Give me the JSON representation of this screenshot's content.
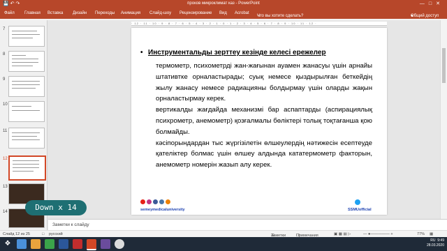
{
  "window": {
    "title": "проков микроклимат каз - PowerPoint"
  },
  "ribbon": {
    "tabs": [
      "Файл",
      "Главная",
      "Вставка",
      "Дизайн",
      "Переходы",
      "Анимация",
      "Слайд-шоу",
      "Рецензирование",
      "Вид",
      "Acrobat"
    ],
    "tell_me": "Что вы хотите сделать?",
    "share": "Общий доступ"
  },
  "thumbnails": [
    {
      "num": "7"
    },
    {
      "num": "8"
    },
    {
      "num": "9"
    },
    {
      "num": "10"
    },
    {
      "num": "11"
    },
    {
      "num": "12"
    },
    {
      "num": "13"
    },
    {
      "num": "14"
    }
  ],
  "slide": {
    "bullet": "Инструментальды  зерттеу кезінде келесі ережелер",
    "paragraphs": [
      "термометр, психометрді жан-жағынан ауамен жанасуы үшін арнайы штативтке орналастырады; суық немесе қыздырылған беткейдің жылу жанасу немесе радиацияны болдырмау үшін оларды жақын орналастырмау керек.",
      "вертикалды жағдайда механизмі бар аспаптарды (аспирациялық психрометр, анемометр) қозғалмалы бөліктері толық тоқтағанша қою болмайды.",
      "кәсіпорындардан тыс жүргізілетін өлшеулердің нәтижесін есептеуде қателіктер болмас үшін өлшеу алдында кататермометр факторын, анемометр номерін жазып алу керек."
    ],
    "footer_left": "semeymedicaluniversity",
    "footer_right": "SSMUofficial"
  },
  "notes": {
    "placeholder": "Заметки к слайду"
  },
  "overlay": {
    "text": "Down x 14"
  },
  "status": {
    "slide": "Слайд 12 из 25",
    "lang": "русский",
    "notes": "Заметки",
    "comments": "Примечания",
    "zoom": "77%"
  },
  "taskbar": {
    "time": "9:49",
    "date": "28.03.2020",
    "lang": "RU"
  }
}
